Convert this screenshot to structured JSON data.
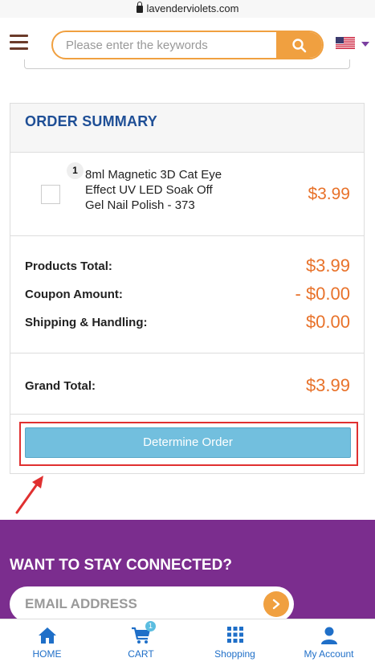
{
  "browser": {
    "url": "lavenderviolets.com"
  },
  "header": {
    "search_placeholder": "Please enter the keywords",
    "country": "US"
  },
  "order_summary": {
    "title": "ORDER SUMMARY",
    "item": {
      "quantity": "1",
      "name": "8ml Magnetic 3D Cat Eye Effect UV LED Soak Off Gel Nail Polish - 373",
      "price": "$3.99"
    },
    "totals": [
      {
        "label": "Products Total:",
        "value": "$3.99"
      },
      {
        "label": "Coupon Amount:",
        "value": "- $0.00"
      },
      {
        "label": "Shipping & Handling:",
        "value": "$0.00"
      }
    ],
    "grand_total": {
      "label": "Grand Total:",
      "value": "$3.99"
    },
    "determine_button": "Determine Order"
  },
  "newsletter": {
    "title": "WANT TO STAY CONNECTED?",
    "email_placeholder": "EMAIL ADDRESS"
  },
  "bottom_nav": {
    "home": "HOME",
    "cart": "CART",
    "cart_count": "1",
    "shopping": "Shopping",
    "account": "My Account"
  },
  "colors": {
    "accent_orange": "#f0a040",
    "price_orange": "#e8722a",
    "title_blue": "#1f4f96",
    "button_blue": "#72bfde",
    "newsletter_purple": "#7b2d8e",
    "highlight_red": "#e03030"
  }
}
